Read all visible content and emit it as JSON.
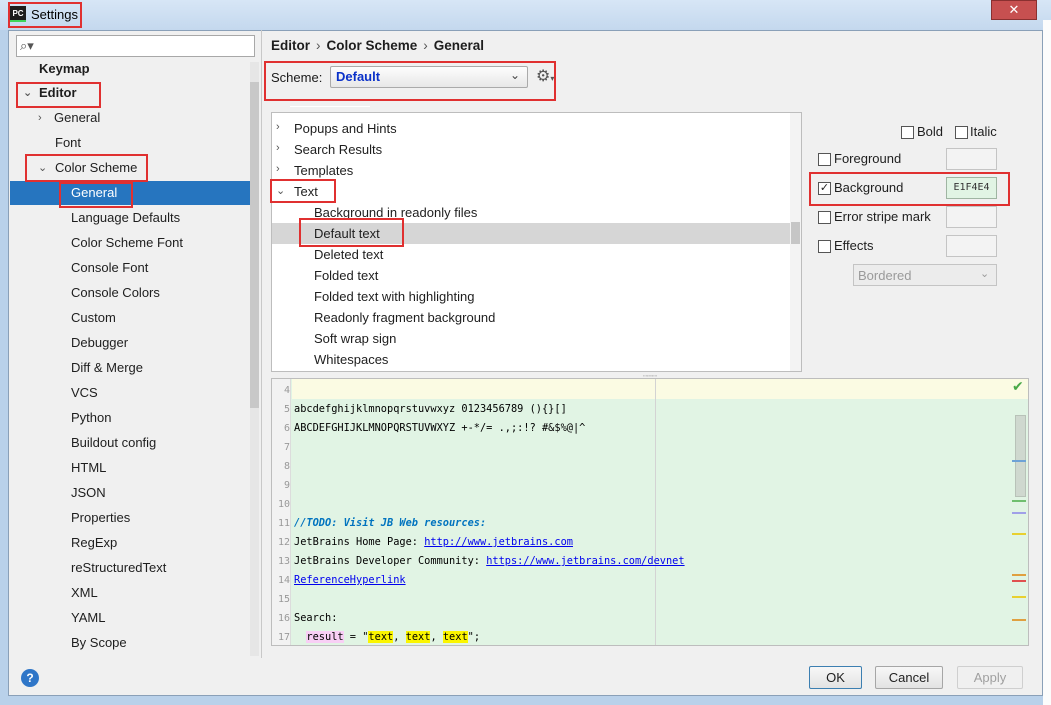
{
  "window": {
    "title": "Settings",
    "app_icon": "PC",
    "close_glyph": "✕"
  },
  "sidebar": {
    "search_placeholder": "",
    "items": [
      {
        "label": "Keymap"
      },
      {
        "label": "Editor"
      },
      {
        "label": "General"
      },
      {
        "label": "Font"
      },
      {
        "label": "Color Scheme"
      },
      {
        "label": "General"
      },
      {
        "label": "Language Defaults"
      },
      {
        "label": "Color Scheme Font"
      },
      {
        "label": "Console Font"
      },
      {
        "label": "Console Colors"
      },
      {
        "label": "Custom"
      },
      {
        "label": "Debugger"
      },
      {
        "label": "Diff & Merge"
      },
      {
        "label": "VCS"
      },
      {
        "label": "Python"
      },
      {
        "label": "Buildout config"
      },
      {
        "label": "HTML"
      },
      {
        "label": "JSON"
      },
      {
        "label": "Properties"
      },
      {
        "label": "RegExp"
      },
      {
        "label": "reStructuredText"
      },
      {
        "label": "XML"
      },
      {
        "label": "YAML"
      },
      {
        "label": "By Scope"
      }
    ]
  },
  "breadcrumb": [
    "Editor",
    "Color Scheme",
    "General"
  ],
  "breadcrumb_sep": "›",
  "scheme": {
    "label": "Scheme:",
    "value": "Default"
  },
  "elements": [
    {
      "label": "Popups and Hints"
    },
    {
      "label": "Search Results"
    },
    {
      "label": "Templates"
    },
    {
      "label": "Text"
    },
    {
      "label": "Background in readonly files"
    },
    {
      "label": "Default text"
    },
    {
      "label": "Deleted text"
    },
    {
      "label": "Folded text"
    },
    {
      "label": "Folded text with highlighting"
    },
    {
      "label": "Readonly fragment background"
    },
    {
      "label": "Soft wrap sign"
    },
    {
      "label": "Whitespaces"
    }
  ],
  "attributes": {
    "bold": {
      "label": "Bold",
      "checked": false
    },
    "italic": {
      "label": "Italic",
      "checked": false
    },
    "foreground": {
      "label": "Foreground",
      "checked": false
    },
    "background": {
      "label": "Background",
      "checked": true,
      "value": "E1F4E4"
    },
    "error_stripe": {
      "label": "Error stripe mark",
      "checked": false
    },
    "effects": {
      "label": "Effects",
      "checked": false,
      "type": "Bordered"
    }
  },
  "preview": {
    "line_numbers": [
      "4",
      "5",
      "6",
      "7",
      "8",
      "9",
      "10",
      "11",
      "12",
      "13",
      "14",
      "15",
      "16",
      "17"
    ],
    "line5": "abcdefghijklmnopqrstuvwxyz 0123456789 (){}[]",
    "line6": "ABCDEFGHIJKLMNOPQRSTUVWXYZ +-*/= .,;:!? #&$%@|^",
    "line11": "//TODO: Visit JB Web resources:",
    "line12_prefix": "JetBrains Home Page: ",
    "line12_link": "http://www.jetbrains.com",
    "line13_prefix": "JetBrains Developer Community: ",
    "line13_link": "https://www.jetbrains.com/devnet",
    "line14_link": "ReferenceHyperlink",
    "line16": "Search:",
    "line17_var": "result",
    "line17_eq": " = \"",
    "line17_word": "text",
    "line17_sep": ", ",
    "line17_end": "\";",
    "background_color": "#e1f4e4"
  },
  "buttons": {
    "ok": "OK",
    "cancel": "Cancel",
    "apply": "Apply",
    "help": "?"
  },
  "colors": {
    "selection": "#2675bf",
    "highlight_box": "#e03030",
    "scheme_value": "#0a31c9"
  }
}
